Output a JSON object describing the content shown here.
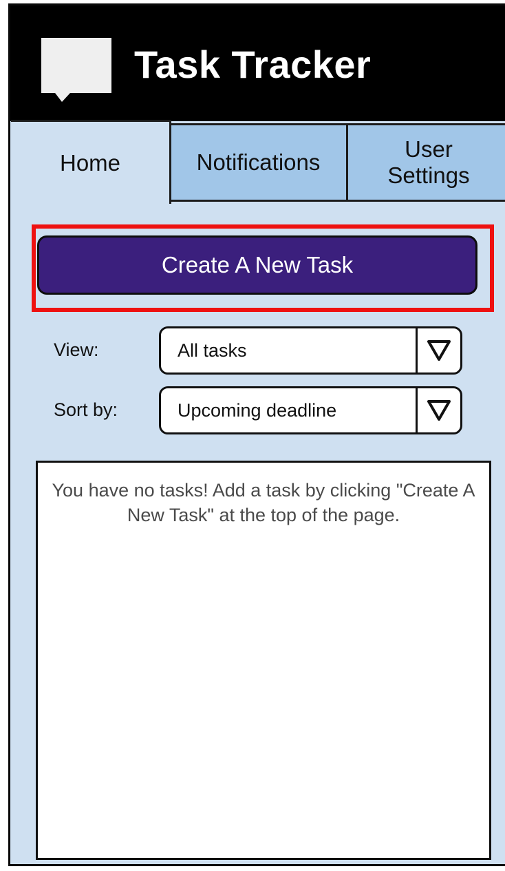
{
  "app": {
    "title": "Task Tracker",
    "logo_icon": "speech-bubble-icon"
  },
  "tabs": [
    {
      "label": "Home",
      "active": true
    },
    {
      "label": "Notifications",
      "active": false
    },
    {
      "label": "User Settings",
      "active": false
    }
  ],
  "actions": {
    "create_label": "Create A New Task"
  },
  "filters": {
    "view": {
      "label": "View:",
      "value": "All tasks",
      "icon": "triangle-down-icon"
    },
    "sort": {
      "label": "Sort by:",
      "value": "Upcoming deadline",
      "icon": "triangle-down-icon"
    }
  },
  "task_list": {
    "empty_message": "You have no tasks!  Add a task by clicking \"Create A New Task\" at the top of the page."
  },
  "colors": {
    "header_bg": "#000000",
    "body_bg": "#cfe0f1",
    "inactive_tab_bg": "#a1c6e8",
    "primary_button": "#3b1f7d",
    "highlight_outline": "#ee1111"
  }
}
